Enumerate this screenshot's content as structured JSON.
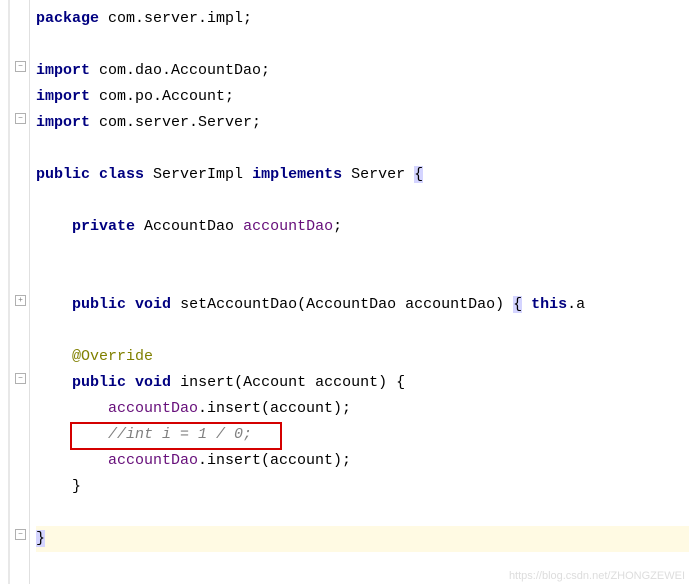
{
  "code": {
    "package_kw": "package",
    "package_val": " com.server.impl;",
    "import_kw": "import",
    "import1": " com.dao.AccountDao;",
    "import2": " com.po.Account;",
    "import3": " com.server.Server;",
    "public_kw": "public",
    "class_kw": "class",
    "class_name": " ServerImpl ",
    "implements_kw": "implements",
    "impl_name": " Server ",
    "brace_open": "{",
    "brace_close": "}",
    "private_kw": "private",
    "field_type": " AccountDao ",
    "field_name": "accountDao",
    "semicolon": ";",
    "void_kw": "void",
    "setter_name": " setAccountDao(AccountDao accountDao) ",
    "this_kw": "this",
    "setter_tail": ".a",
    "override": "@Override",
    "insert_name": " insert(Account account) ",
    "insert_call1": ".insert(account);",
    "comment_line": "//int i = 1 / 0;",
    "insert_call2": ".insert(account);"
  },
  "watermark": "https://blog.csdn.net/ZHONGZEWEI"
}
